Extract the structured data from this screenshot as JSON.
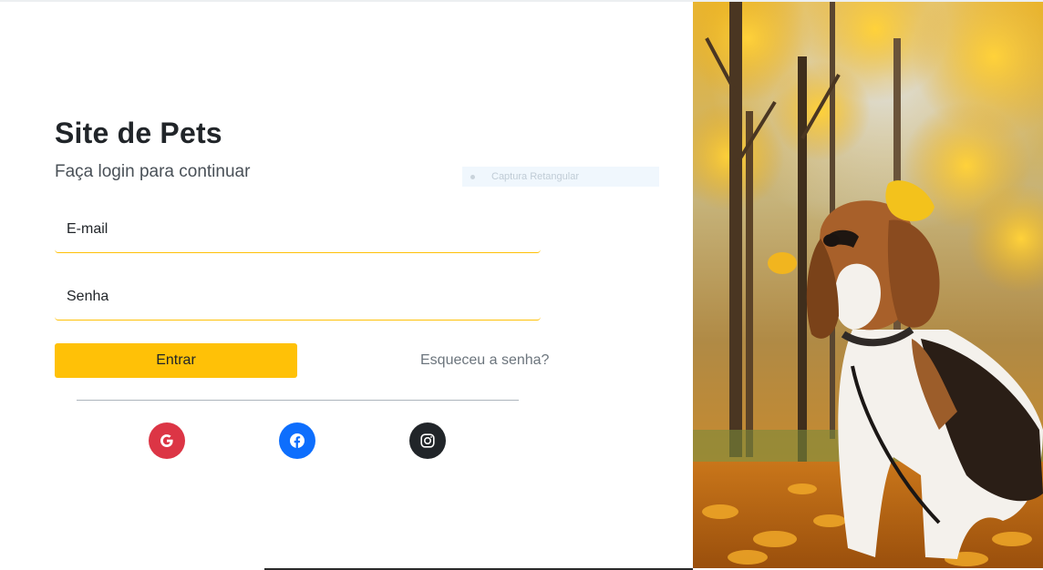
{
  "login": {
    "title": "Site de Pets",
    "subtitle": "Faça login para continuar",
    "email_label": "E-mail",
    "password_label": "Senha",
    "submit_label": "Entrar",
    "forgot_label": "Esqueceu a senha?"
  },
  "overlay": {
    "capture_label": "Captura Retangular"
  },
  "social": [
    {
      "icon": "google-icon",
      "color": "#dc3545"
    },
    {
      "icon": "facebook-icon",
      "color": "#0d6efd"
    },
    {
      "icon": "instagram-icon",
      "color": "#212529"
    }
  ],
  "colors": {
    "accent": "#ffc107",
    "text": "#212529",
    "muted": "#6c757d"
  },
  "hero_image": {
    "icon": "dog-photo"
  }
}
